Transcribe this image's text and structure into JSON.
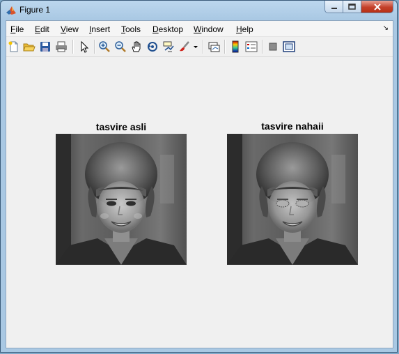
{
  "window": {
    "title": "Figure 1",
    "icon": "matlab-icon"
  },
  "menu": [
    {
      "label": "File",
      "accel": "F",
      "rest": "ile"
    },
    {
      "label": "Edit",
      "accel": "E",
      "rest": "dit"
    },
    {
      "label": "View",
      "accel": "V",
      "rest": "iew"
    },
    {
      "label": "Insert",
      "accel": "I",
      "rest": "nsert"
    },
    {
      "label": "Tools",
      "accel": "T",
      "rest": "ools"
    },
    {
      "label": "Desktop",
      "accel": "D",
      "rest": "esktop"
    },
    {
      "label": "Window",
      "accel": "W",
      "rest": "indow"
    },
    {
      "label": "Help",
      "accel": "H",
      "rest": "elp"
    }
  ],
  "toolbar": [
    "new-figure-icon",
    "open-file-icon",
    "save-icon",
    "print-icon",
    "edit-plot-arrow-icon",
    "zoom-in-icon",
    "zoom-out-icon",
    "pan-hand-icon",
    "rotate-3d-icon",
    "data-cursor-icon",
    "brush-icon",
    "brush-dropdown-icon",
    "link-plot-icon",
    "insert-colorbar-icon",
    "insert-legend-icon",
    "hide-plot-tools-icon",
    "show-plot-tools-icon"
  ],
  "axes": [
    {
      "title": "tasvire asli"
    },
    {
      "title": "tasvire nahaii"
    }
  ]
}
